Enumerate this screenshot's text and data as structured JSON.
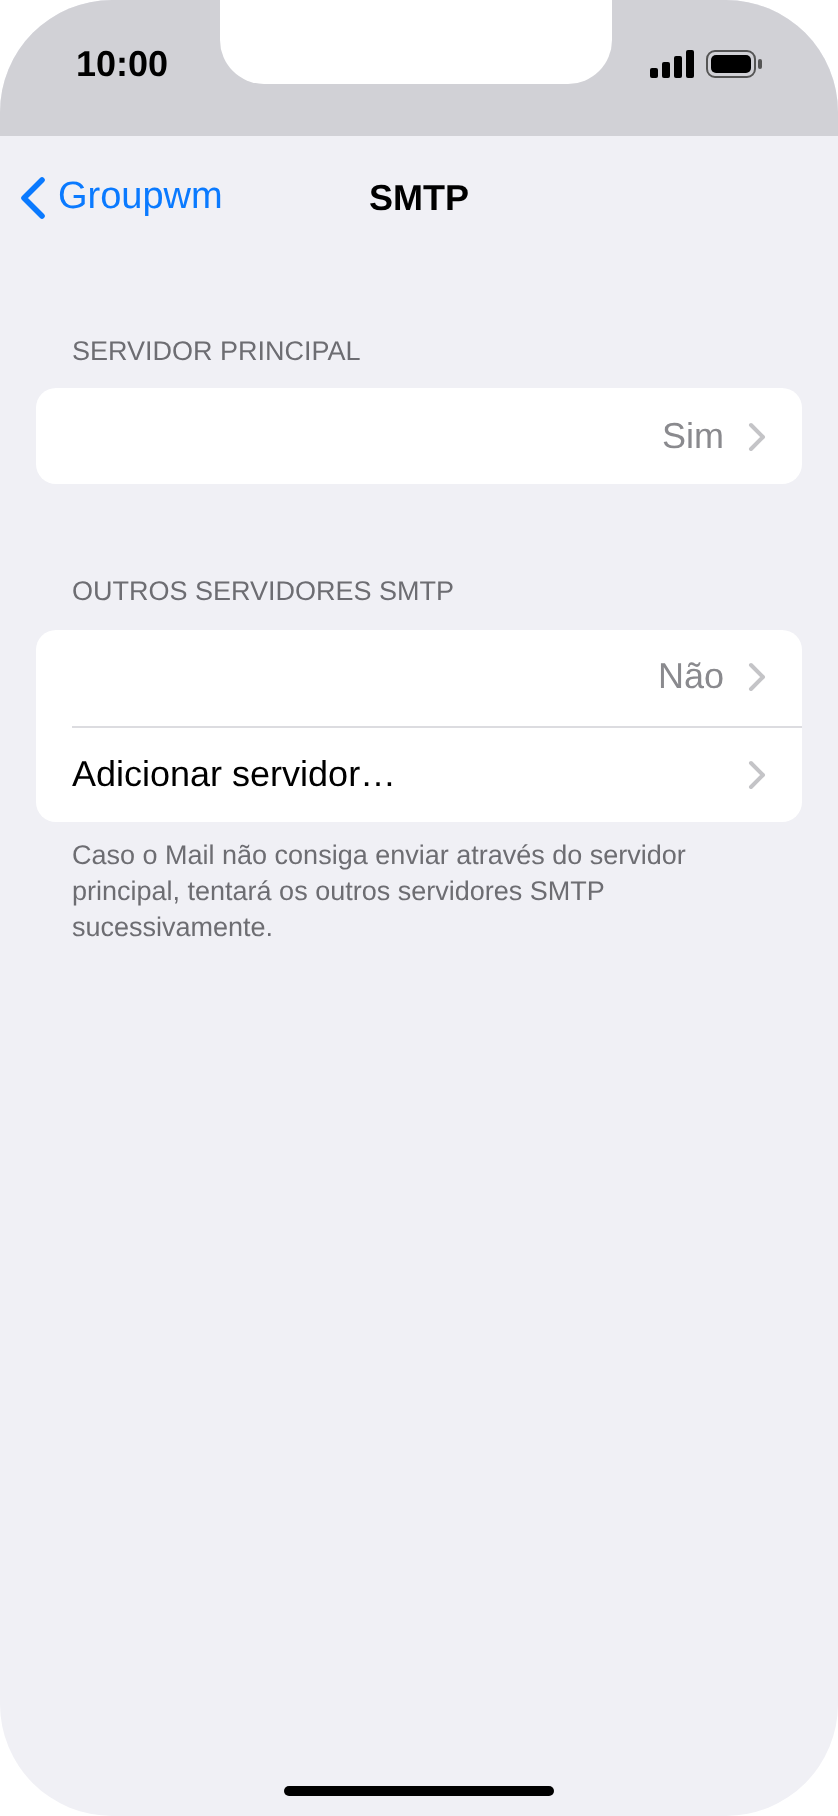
{
  "status_bar": {
    "time": "10:00"
  },
  "nav": {
    "back": "Groupwm",
    "title": "SMTP"
  },
  "sections": [
    {
      "header": "SERVIDOR PRINCIPAL",
      "rows": [
        {
          "kind": "value",
          "value": "Sim"
        }
      ]
    },
    {
      "header": "OUTROS SERVIDORES SMTP",
      "rows": [
        {
          "kind": "value",
          "value": "Não"
        },
        {
          "kind": "action",
          "label": "Adicionar servidor…"
        }
      ],
      "footer": "Caso o Mail não consiga enviar através do servidor principal, tentará os outros servidores SMTP sucessivamente."
    }
  ]
}
